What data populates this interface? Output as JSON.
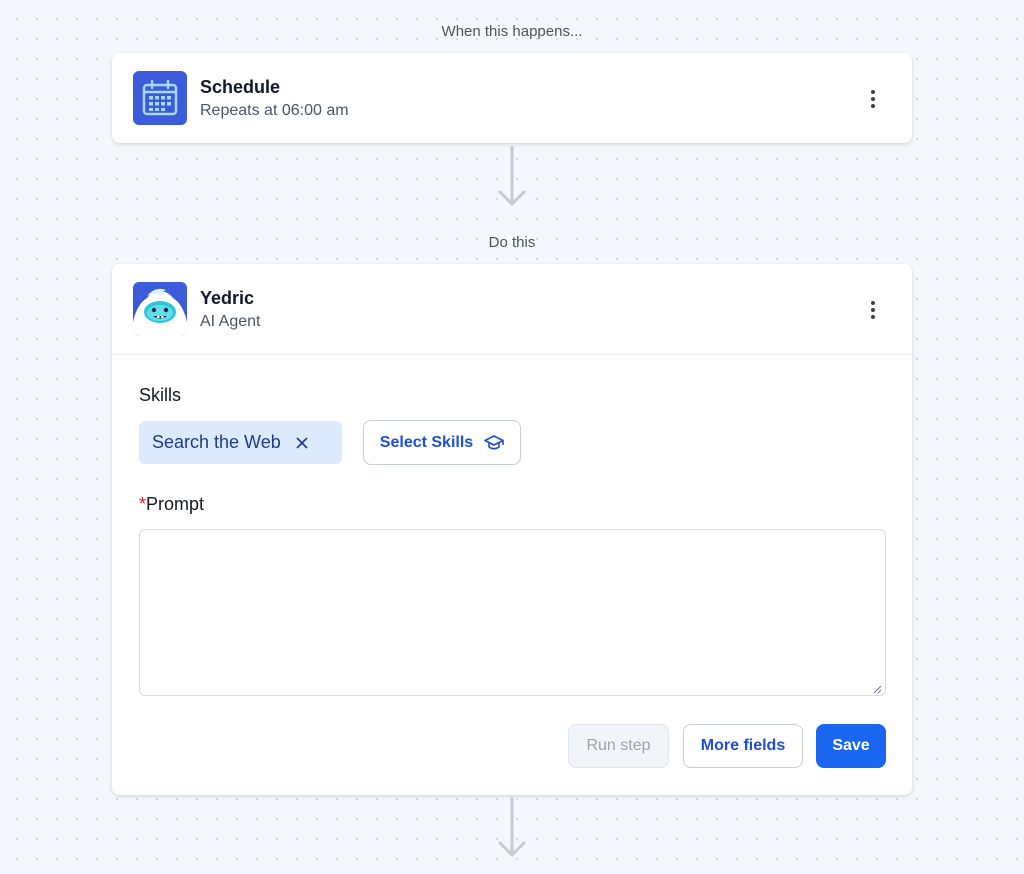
{
  "trigger": {
    "caption": "When this happens...",
    "title": "Schedule",
    "subtitle": "Repeats at 06:00 am",
    "icon": "calendar-icon",
    "icon_bg": "#3b5bdb"
  },
  "action": {
    "caption": "Do this",
    "title": "Yedric",
    "subtitle": "AI Agent",
    "icon": "yeti-agent-icon",
    "skills": {
      "label": "Skills",
      "chips": [
        {
          "label": "Search the Web"
        }
      ],
      "select_label": "Select Skills"
    },
    "prompt": {
      "required_mark": "*",
      "label": "Prompt",
      "value": ""
    },
    "buttons": {
      "run_step": "Run step",
      "more_fields": "More fields",
      "save": "Save"
    }
  },
  "colors": {
    "accent": "#1a66f0",
    "chip_bg": "#dbeafe",
    "required": "#e11d1d"
  }
}
